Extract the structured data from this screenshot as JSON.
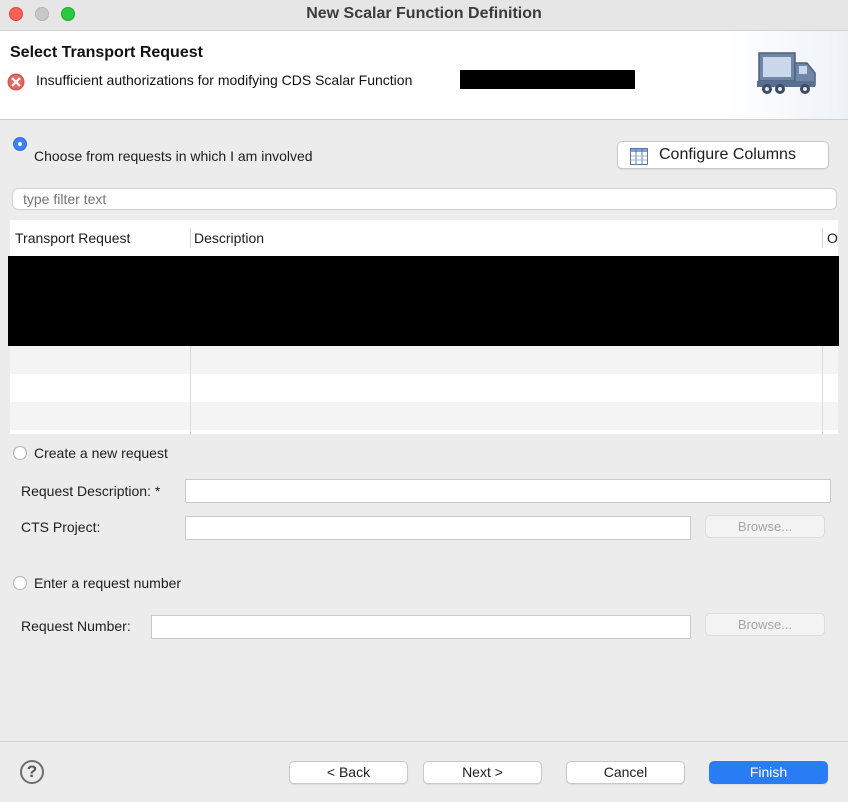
{
  "window": {
    "title": "New Scalar Function Definition"
  },
  "header": {
    "title": "Select Transport Request",
    "error_message": "Insufficient authorizations for modifying CDS Scalar Function",
    "error_icon": "error-circle-icon",
    "banner_icon": "transport-truck-icon"
  },
  "choose_option": {
    "label": "Choose from requests in which I am involved",
    "selected": true,
    "configure_columns_label": "Configure Columns",
    "filter_placeholder": "type filter text"
  },
  "table": {
    "columns": [
      "Transport Request",
      "Description",
      "O"
    ]
  },
  "create_option": {
    "label": "Create a new request",
    "selected": false,
    "request_description_label": "Request Description: *",
    "request_description_value": "",
    "cts_project_label": "CTS Project:",
    "cts_project_value": "",
    "browse_label": "Browse..."
  },
  "enter_option": {
    "label": "Enter a request number",
    "selected": false,
    "request_number_label": "Request Number:",
    "request_number_value": "",
    "browse_label": "Browse..."
  },
  "footer": {
    "help_label": "?",
    "back_label": "< Back",
    "next_label": "Next >",
    "cancel_label": "Cancel",
    "finish_label": "Finish"
  },
  "colors": {
    "accent": "#2a7cf4",
    "error": "#d9534f"
  }
}
